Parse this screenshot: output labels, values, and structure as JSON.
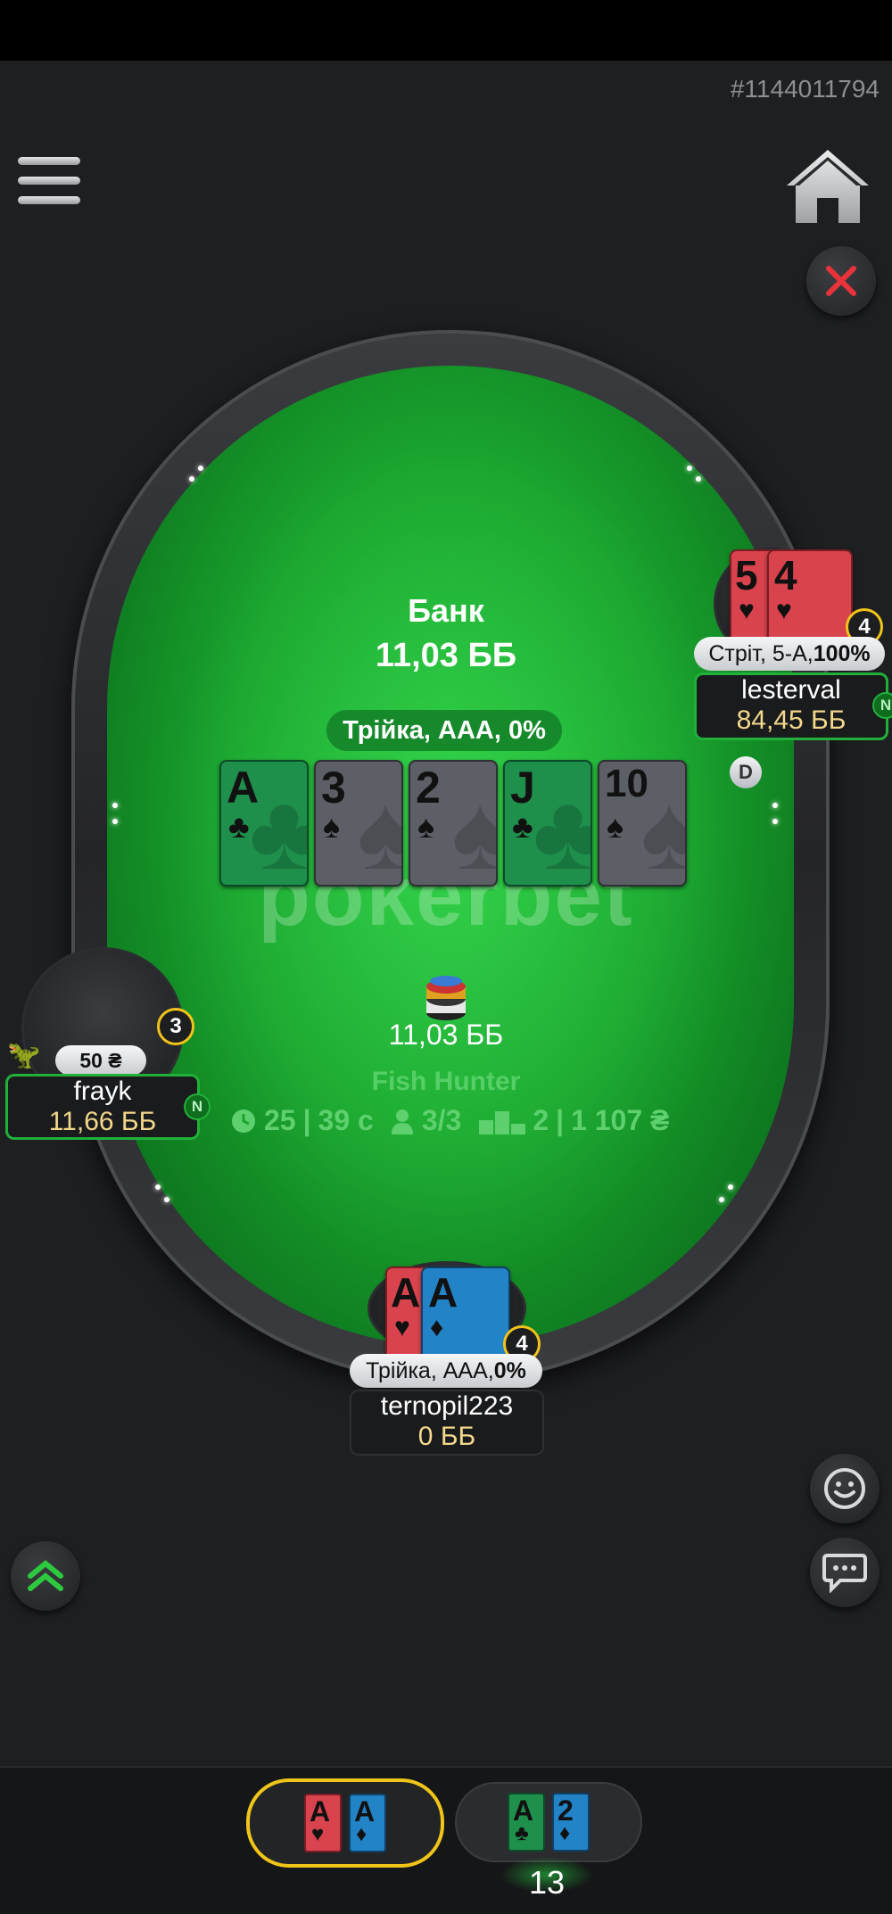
{
  "hand_id": "#1144011794",
  "icons": {
    "menu": "menu-icon",
    "home": "home-icon",
    "close": "close-icon",
    "emoji": "emoji-icon",
    "chat": "chat-icon",
    "expand": "chevron-up-icon"
  },
  "pot": {
    "label": "Банк",
    "value": "11,03 ББ"
  },
  "board_combo": "Трійка, ААА, 0%",
  "board": [
    {
      "rank": "A",
      "suit": "♣",
      "color": "green"
    },
    {
      "rank": "3",
      "suit": "♠",
      "color": "gray"
    },
    {
      "rank": "2",
      "suit": "♠",
      "color": "gray"
    },
    {
      "rank": "J",
      "suit": "♣",
      "color": "green"
    },
    {
      "rank": "10",
      "suit": "♠",
      "color": "gray"
    }
  ],
  "watermark": "pokerbet",
  "center_pot": "11,03 ББ",
  "tournament": {
    "name": "Fish Hunter",
    "level": "25",
    "time": "39 с",
    "players": "3/3",
    "place": "2",
    "prize": "1 107 ₴"
  },
  "players": {
    "right": {
      "name": "lesterval",
      "stack": "84,45 ББ",
      "hand_text": "Стріт, 5-А, ",
      "hand_pct": "100%",
      "timer": "4",
      "badge": "N",
      "cards": [
        {
          "rank": "5",
          "suit": "♥"
        },
        {
          "rank": "4",
          "suit": "♥"
        }
      ]
    },
    "left": {
      "name": "frayk",
      "stack": "11,66 ББ",
      "bet": "50 ₴",
      "timer": "3",
      "badge": "N"
    },
    "hero": {
      "name": "ternopil223",
      "stack": "0 ББ",
      "hand_text": "Трійка, ААА, ",
      "hand_pct": "0%",
      "timer": "4",
      "cards": [
        {
          "rank": "A",
          "suit": "♥"
        },
        {
          "rank": "A",
          "suit": "♦"
        }
      ]
    }
  },
  "dealer_button": "D",
  "tables": [
    {
      "cards": [
        {
          "rank": "A",
          "suit": "♥"
        },
        {
          "rank": "A",
          "suit": "♦"
        }
      ],
      "active": true
    },
    {
      "cards": [
        {
          "rank": "A",
          "suit": "♣"
        },
        {
          "rank": "2",
          "suit": "♦"
        }
      ],
      "active": false,
      "count": "13"
    }
  ],
  "colors": {
    "felt": "#1aa52f",
    "accent_green": "#21b03a",
    "active_tab": "#f0c419",
    "stack": "#f3d78a"
  }
}
